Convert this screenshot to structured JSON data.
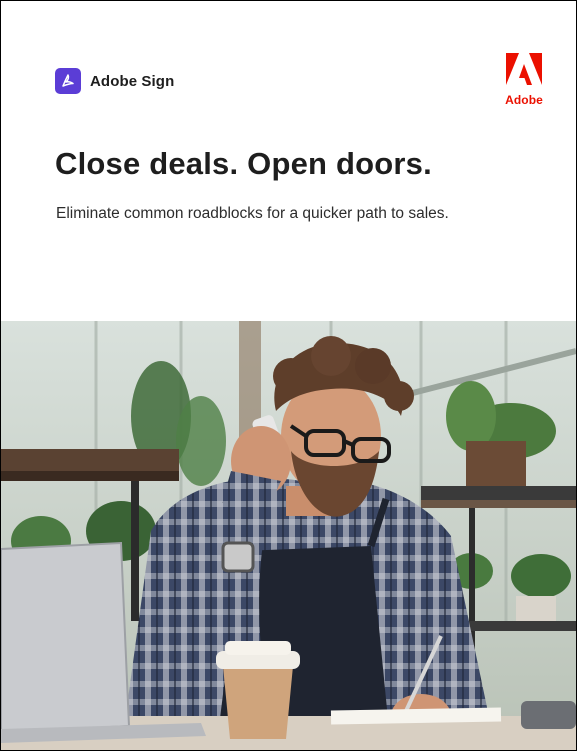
{
  "brand": {
    "product_name": "Adobe Sign",
    "product_icon": "adobe-sign-icon",
    "icon_color": "#5b3dd6"
  },
  "adobe_logo": {
    "wordmark": "Adobe",
    "icon": "adobe-logo-icon",
    "color": "#eb1000"
  },
  "hero": {
    "headline": "Close deals. Open doors.",
    "subheadline": "Eliminate common roadblocks for a quicker path to sales."
  },
  "photo": {
    "subject": "hero-photo"
  }
}
